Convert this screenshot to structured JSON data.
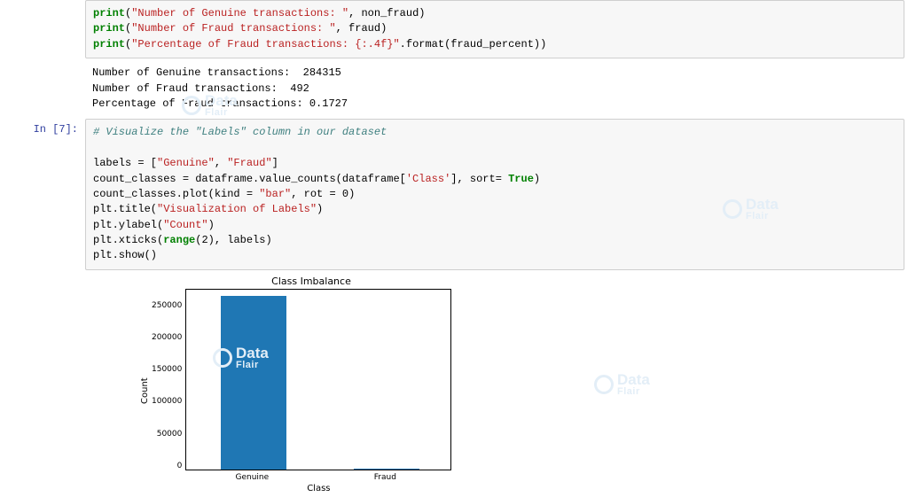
{
  "cell1": {
    "code": {
      "l1a": "print",
      "l1b": "(",
      "l1c": "\"Number of Genuine transactions: \"",
      "l1d": ", non_fraud)",
      "l2a": "print",
      "l2b": "(",
      "l2c": "\"Number of Fraud transactions: \"",
      "l2d": ", fraud)",
      "l3a": "print",
      "l3b": "(",
      "l3c": "\"Percentage of Fraud transactions: {:.4f}\"",
      "l3d": ".format(fraud_percent))"
    },
    "output": "Number of Genuine transactions:  284315\nNumber of Fraud transactions:  492\nPercentage of Fraud transactions: 0.1727"
  },
  "cell2": {
    "prompt": "In [7]:",
    "code": {
      "comment": "# Visualize the \"Labels\" column in our dataset",
      "l2": "labels = [",
      "l2s1": "\"Genuine\"",
      "l2m": ", ",
      "l2s2": "\"Fraud\"",
      "l2e": "]",
      "l3a": "count_classes = dataframe.value_counts(dataframe[",
      "l3s": "'Class'",
      "l3b": "], sort= ",
      "l3bool": "True",
      "l3c": ")",
      "l4a": "count_classes.plot(kind = ",
      "l4s": "\"bar\"",
      "l4b": ", rot = ",
      "l4n": "0",
      "l4c": ")",
      "l5a": "plt.title(",
      "l5s": "\"Visualization of Labels\"",
      "l5b": ")",
      "l6a": "plt.ylabel(",
      "l6s": "\"Count\"",
      "l6b": ")",
      "l7a": "plt.xticks(",
      "l7k": "range",
      "l7b": "(",
      "l7n": "2",
      "l7c": "), labels)",
      "l8": "plt.show()"
    }
  },
  "chart_data": {
    "type": "bar",
    "title": "Class Imbalance",
    "xlabel": "Class",
    "ylabel": "Count",
    "categories": [
      "Genuine",
      "Fraud"
    ],
    "values": [
      284315,
      492
    ],
    "yticks": [
      "250000",
      "200000",
      "150000",
      "100000",
      "50000",
      "0"
    ],
    "ylim": [
      0,
      280000
    ]
  },
  "watermark": {
    "d": "Data",
    "f": "Flair"
  }
}
